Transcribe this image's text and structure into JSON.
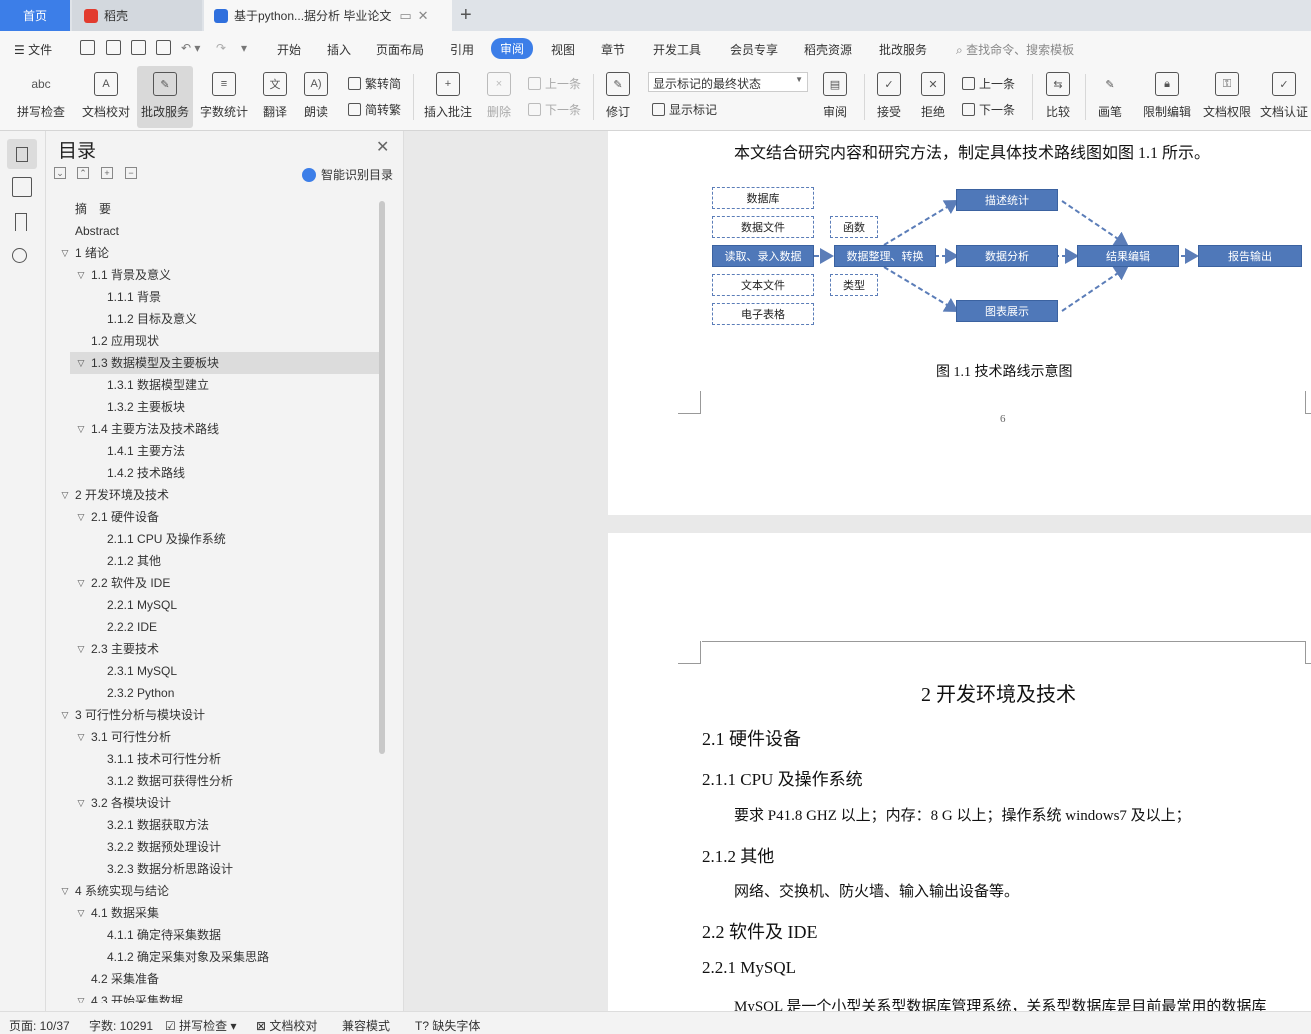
{
  "tabs": {
    "home": "首页",
    "daoke": "稻壳",
    "doc": "基于python...据分析 毕业论文"
  },
  "menu": {
    "file": "文件",
    "items": [
      "开始",
      "插入",
      "页面布局",
      "引用",
      "审阅",
      "视图",
      "章节",
      "开发工具",
      "会员专享",
      "稻壳资源",
      "批改服务"
    ],
    "active_index": 4,
    "search": "查找命令、搜索模板"
  },
  "ribbon": {
    "spellcheck": "拼写检查",
    "doc_proof": "文档校对",
    "review_service": "批改服务",
    "word_count": "字数统计",
    "translate": "翻译",
    "read_aloud": "朗读",
    "to_traditional": "繁转简",
    "to_simplified": "简转繁",
    "insert_comment": "插入批注",
    "delete": "删除",
    "prev_comment": "上一条",
    "next_comment": "下一条",
    "track_changes": "修订",
    "markup_state": "显示标记的最终状态",
    "show_markup": "显示标记",
    "review_pane": "审阅",
    "accept": "接受",
    "reject": "拒绝",
    "prev_change": "上一条",
    "next_change": "下一条",
    "compare": "比较",
    "pen": "画笔",
    "restrict_edit": "限制编辑",
    "doc_permission": "文档权限",
    "doc_cert": "文档认证"
  },
  "toc": {
    "title": "目录",
    "smart": "智能识别目录",
    "items": [
      {
        "text": "摘　要",
        "level": 0,
        "arrow": ""
      },
      {
        "text": "Abstract",
        "level": 0,
        "arrow": ""
      },
      {
        "text": "1  绪论",
        "level": 0,
        "arrow": "v"
      },
      {
        "text": "1.1  背景及意义",
        "level": 1,
        "arrow": "v"
      },
      {
        "text": "1.1.1  背景",
        "level": 2,
        "arrow": ""
      },
      {
        "text": "1.1.2  目标及意义",
        "level": 2,
        "arrow": ""
      },
      {
        "text": "1.2  应用现状",
        "level": 1,
        "arrow": ""
      },
      {
        "text": "1.3  数据模型及主要板块",
        "level": 1,
        "arrow": "v"
      },
      {
        "text": "1.3.1 数据模型建立",
        "level": 2,
        "arrow": ""
      },
      {
        "text": "1.3.2  主要板块",
        "level": 2,
        "arrow": ""
      },
      {
        "text": "1.4  主要方法及技术路线",
        "level": 1,
        "arrow": "v"
      },
      {
        "text": "1.4.1  主要方法",
        "level": 2,
        "arrow": ""
      },
      {
        "text": "1.4.2 技术路线",
        "level": 2,
        "arrow": ""
      },
      {
        "text": "2 开发环境及技术",
        "level": 0,
        "arrow": "v"
      },
      {
        "text": "2.1 硬件设备",
        "level": 1,
        "arrow": "v"
      },
      {
        "text": "2.1.1 CPU 及操作系统",
        "level": 2,
        "arrow": ""
      },
      {
        "text": "2.1.2  其他",
        "level": 2,
        "arrow": ""
      },
      {
        "text": "2.2 软件及 IDE",
        "level": 1,
        "arrow": "v"
      },
      {
        "text": "2.2.1 MySQL",
        "level": 2,
        "arrow": ""
      },
      {
        "text": "2.2.2 IDE",
        "level": 2,
        "arrow": ""
      },
      {
        "text": "2.3 主要技术",
        "level": 1,
        "arrow": "v"
      },
      {
        "text": "2.3.1 MySQL",
        "level": 2,
        "arrow": ""
      },
      {
        "text": "2.3.2 Python",
        "level": 2,
        "arrow": ""
      },
      {
        "text": "3  可行性分析与模块设计",
        "level": 0,
        "arrow": "v"
      },
      {
        "text": "3.1  可行性分析",
        "level": 1,
        "arrow": "v"
      },
      {
        "text": "3.1.1  技术可行性分析",
        "level": 2,
        "arrow": ""
      },
      {
        "text": "3.1.2  数据可获得性分析",
        "level": 2,
        "arrow": ""
      },
      {
        "text": "3.2  各模块设计",
        "level": 1,
        "arrow": "v"
      },
      {
        "text": "3.2.1  数据获取方法",
        "level": 2,
        "arrow": ""
      },
      {
        "text": "3.2.2  数据预处理设计",
        "level": 2,
        "arrow": ""
      },
      {
        "text": "3.2.3  数据分析思路设计",
        "level": 2,
        "arrow": ""
      },
      {
        "text": "4  系统实现与结论",
        "level": 0,
        "arrow": "v"
      },
      {
        "text": "4.1 数据采集",
        "level": 1,
        "arrow": "v"
      },
      {
        "text": "4.1.1 确定待采集数据",
        "level": 2,
        "arrow": ""
      },
      {
        "text": "4.1.2 确定采集对象及采集思路",
        "level": 2,
        "arrow": ""
      },
      {
        "text": "4.2 采集准备",
        "level": 1,
        "arrow": ""
      },
      {
        "text": "4.3 开始采集数据",
        "level": 1,
        "arrow": "v"
      }
    ],
    "selected_index": 7
  },
  "document": {
    "intro_line": "本文结合研究内容和研究方法，制定具体技术路线图如图 1.1 所示。",
    "flow": {
      "db": "数据库",
      "datafile": "数据文件",
      "read": "读取、录入数据",
      "textfile": "文本文件",
      "spreadsheet": "电子表格",
      "func": "函数",
      "type": "类型",
      "process": "数据整理、转换",
      "desc_stats": "描述统计",
      "analysis": "数据分析",
      "charts": "图表展示",
      "result": "结果编辑",
      "report": "报告输出"
    },
    "figure_caption": "图 1.1 技术路线示意图",
    "page_number": "6",
    "chapter_title": "2 开发环境及技术",
    "h_2_1": "2.1 硬件设备",
    "h_2_1_1": "2.1.1 CPU 及操作系统",
    "p_cpu": "要求 P41.8 GHZ  以上；内存：8 G  以上；操作系统 windows7 及以上；",
    "h_2_1_2": "2.1.2  其他",
    "p_other": "网络、交换机、防火墙、输入输出设备等。",
    "h_2_2": "2.2 软件及 IDE",
    "h_2_2_1": "2.2.1 MySQL",
    "p_mysql": "MySQL 是一个小型关系型数据库管理系统，关系型数据库是目前最常用的数据库"
  },
  "status": {
    "page": "页面: 10/37",
    "words": "字数: 10291",
    "spell": "拼写检查",
    "proof": "文档校对",
    "compat": "兼容模式",
    "missing_font": "缺失字体"
  }
}
